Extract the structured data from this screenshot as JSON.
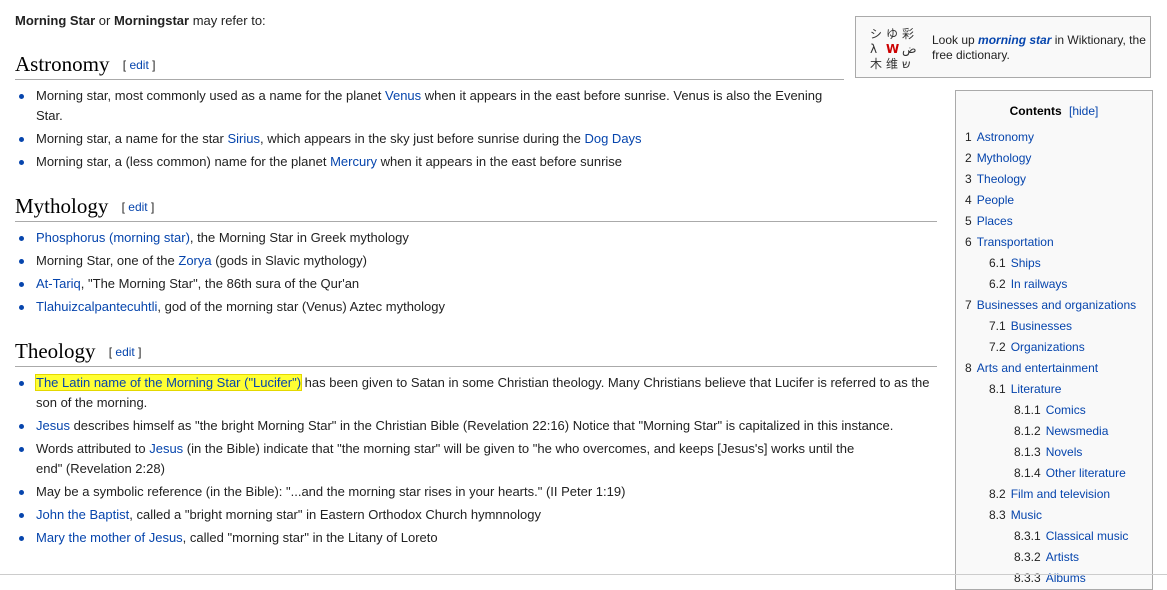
{
  "intro": {
    "term1": "Morning Star",
    "or": " or ",
    "term2": "Morningstar",
    "rest": " may refer to:"
  },
  "wiktionary": {
    "prefix": "Look up ",
    "link": "morning star",
    "suffix": " in Wiktionary, the free dictionary.",
    "logo_glyphs": [
      "シ",
      "ゆ",
      "彩",
      "λ",
      "W",
      "ض",
      "木",
      "维",
      "ש"
    ]
  },
  "sections": {
    "astronomy": {
      "title": "Astronomy",
      "edit": "edit",
      "items": [
        {
          "a": "Morning star, most commonly used as a name for the planet ",
          "link": "Venus",
          "b": " when it appears in the east before sunrise. Venus is also the Evening Star."
        },
        {
          "a": "Morning star, a name for the star ",
          "link": "Sirius",
          "b": ", which appears in the sky just before sunrise during the ",
          "link2": "Dog Days",
          "c": ""
        },
        {
          "a": "Morning star, a (less common) name for the planet ",
          "link": "Mercury",
          "b": " when it appears in the east before sunrise"
        }
      ]
    },
    "mythology": {
      "title": "Mythology",
      "edit": "edit",
      "items": [
        {
          "link": "Phosphorus (morning star)",
          "b": ", the Morning Star in Greek mythology"
        },
        {
          "a": "Morning Star, one of the ",
          "link": "Zorya",
          "b": " (gods in Slavic mythology)"
        },
        {
          "link": "At-Tariq",
          "b": ", \"The Morning Star\", the 86th sura of the Qur'an"
        },
        {
          "link": "Tlahuizcalpantecuhtli",
          "b": ", god of the morning star (Venus) Aztec mythology"
        }
      ]
    },
    "theology": {
      "title": "Theology",
      "edit": "edit",
      "items": [
        {
          "link": "The Latin name of the Morning Star (\"Lucifer\")",
          "b": " has been given to Satan in some Christian theology. Many Christians believe that Lucifer is referred to as the son of the morning."
        },
        {
          "link": "Jesus",
          "b": " describes himself as \"the bright Morning Star\" in the Christian Bible (Revelation 22:16) Notice that \"Morning Star\" is capitalized in this instance."
        },
        {
          "a": "Words attributed to ",
          "link": "Jesus",
          "b": " (in the Bible) indicate that \"the morning star\" will be given to \"he who overcomes, and keeps [Jesus's] works until the end\" (Revelation 2:28)"
        },
        {
          "a": "May be a symbolic reference (in the Bible): \"...and the morning star rises in your hearts.\" (II Peter 1:19)"
        },
        {
          "link": "John the Baptist",
          "b": ", called a \"bright morning star\" in Eastern Orthodox Church hymnnology"
        },
        {
          "link": "Mary the mother of Jesus",
          "b": ", called \"morning star\" in the Litany of Loreto"
        }
      ]
    }
  },
  "toc": {
    "title": "Contents",
    "hide": "[hide]",
    "entries": [
      {
        "num": "1",
        "label": "Astronomy",
        "level": 1
      },
      {
        "num": "2",
        "label": "Mythology",
        "level": 1
      },
      {
        "num": "3",
        "label": "Theology",
        "level": 1
      },
      {
        "num": "4",
        "label": "People",
        "level": 1
      },
      {
        "num": "5",
        "label": "Places",
        "level": 1
      },
      {
        "num": "6",
        "label": "Transportation",
        "level": 1
      },
      {
        "num": "6.1",
        "label": "Ships",
        "level": 2
      },
      {
        "num": "6.2",
        "label": "In railways",
        "level": 2
      },
      {
        "num": "7",
        "label": "Businesses and organizations",
        "level": 1
      },
      {
        "num": "7.1",
        "label": "Businesses",
        "level": 2
      },
      {
        "num": "7.2",
        "label": "Organizations",
        "level": 2
      },
      {
        "num": "8",
        "label": "Arts and entertainment",
        "level": 1
      },
      {
        "num": "8.1",
        "label": "Literature",
        "level": 2
      },
      {
        "num": "8.1.1",
        "label": "Comics",
        "level": 3
      },
      {
        "num": "8.1.2",
        "label": "Newsmedia",
        "level": 3
      },
      {
        "num": "8.1.3",
        "label": "Novels",
        "level": 3
      },
      {
        "num": "8.1.4",
        "label": "Other literature",
        "level": 3
      },
      {
        "num": "8.2",
        "label": "Film and television",
        "level": 2
      },
      {
        "num": "8.3",
        "label": "Music",
        "level": 2
      },
      {
        "num": "8.3.1",
        "label": "Classical music",
        "level": 3
      },
      {
        "num": "8.3.2",
        "label": "Artists",
        "level": 3
      },
      {
        "num": "8.3.3",
        "label": "Albums",
        "level": 3
      }
    ]
  }
}
